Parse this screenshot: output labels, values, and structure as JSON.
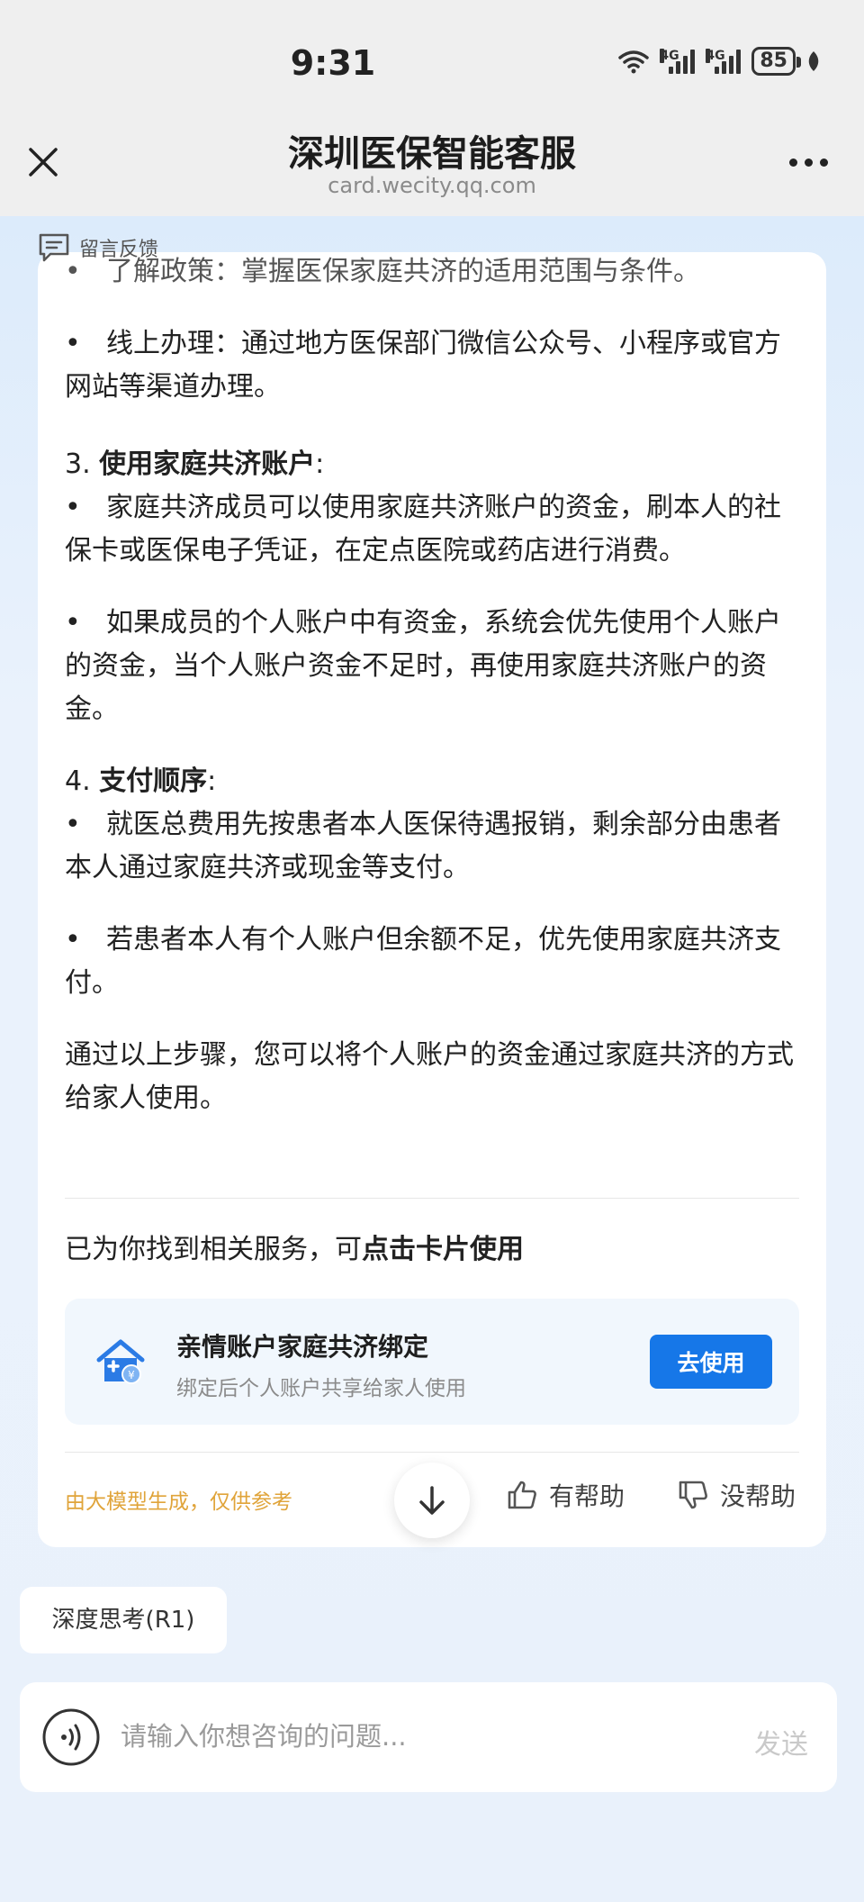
{
  "status_bar": {
    "time": "9:31",
    "network_1": "4G",
    "network_2": "4G",
    "battery": "85"
  },
  "header": {
    "title": "深圳医保智能客服",
    "url": "card.wecity.qq.com"
  },
  "feedback": {
    "label": "留言反馈"
  },
  "content": {
    "bullet_1": "了解政策：掌握医保家庭共济的适用范围与条件。",
    "bullet_2": "线上办理：通过地方医保部门微信公众号、小程序或官方网站等渠道办理。",
    "section_3_num": "3.",
    "section_3_title": "使用家庭共济账户",
    "section_3_colon": ":",
    "bullet_3": "家庭共济成员可以使用家庭共济账户的资金，刷本人的社保卡或医保电子凭证，在定点医院或药店进行消费。",
    "bullet_4": "如果成员的个人账户中有资金，系统会优先使用个人账户的资金，当个人账户资金不足时，再使用家庭共济账户的资金。",
    "section_4_num": "4.",
    "section_4_title": "支付顺序",
    "section_4_colon": ":",
    "bullet_5": "就医总费用先按患者本人医保待遇报销，剩余部分由患者本人通过家庭共济或现金等支付。",
    "bullet_6": "若患者本人有个人账户但余额不足，优先使用家庭共济支付。",
    "summary": "通过以上步骤，您可以将个人账户的资金通过家庭共济的方式给家人使用。"
  },
  "service": {
    "found_prefix": "已为你找到相关服务，可",
    "found_bold": "点击卡片使用",
    "title": "亲情账户家庭共济绑定",
    "subtitle": "绑定后个人账户共享给家人使用",
    "button": "去使用"
  },
  "footer_actions": {
    "disclaimer": "由大模型生成，仅供参考",
    "helpful": "有帮助",
    "not_helpful": "没帮助"
  },
  "chat": {
    "deep_think": "深度思考(R1)",
    "input_placeholder": "请输入你想咨询的问题...",
    "send": "发送"
  },
  "colors": {
    "accent": "#1677e8",
    "disclaimer": "#e0a43a"
  }
}
